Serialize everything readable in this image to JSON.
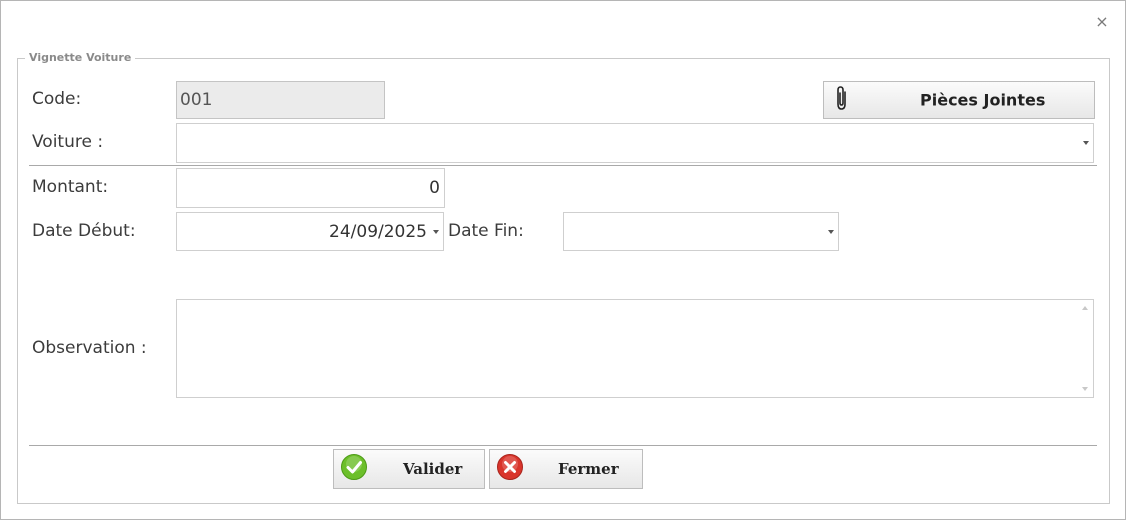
{
  "window": {
    "close_glyph": "×"
  },
  "groupbox": {
    "title": "Vignette Voiture"
  },
  "form": {
    "code_label": "Code:",
    "code_value": "001",
    "voiture_label": "Voiture :",
    "voiture_value": "",
    "montant_label": "Montant:",
    "montant_value": "0",
    "date_debut_label": "Date Début:",
    "date_debut_value": "24/09/2025",
    "date_fin_label": "Date Fin:",
    "date_fin_value": "",
    "observation_label": "Observation :",
    "observation_value": ""
  },
  "buttons": {
    "attachments_label": "Pièces Jointes",
    "validate_label": "Valider",
    "close_label": "Fermer"
  },
  "icons": {
    "attachments": "paperclip-icon",
    "validate": "checkmark-icon",
    "close": "cancel-icon",
    "window_close": "close-icon"
  },
  "colors": {
    "validate_icon": "#6cbf2a",
    "close_icon": "#d9342b"
  }
}
